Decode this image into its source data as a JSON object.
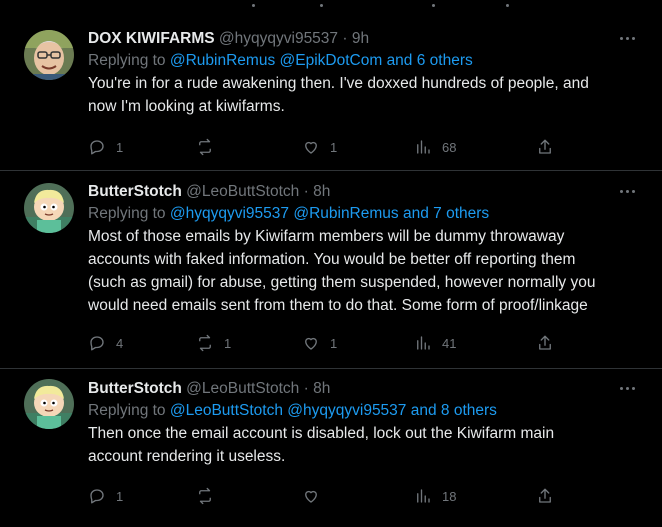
{
  "tweets": [
    {
      "name": "DOX KIWIFARMS",
      "handle": "@hyqyqyvi95537",
      "time": "9h",
      "replying_prefix": "Replying to",
      "replying_users": [
        "@RubinRemus",
        "@EpikDotCom"
      ],
      "replying_others": "and 6 others",
      "lines": [
        "You're in for a rude awakening then. I've doxxed hundreds of people, and",
        "now I'm looking at kiwifarms."
      ],
      "counts": {
        "replies": "1",
        "retweets": "",
        "likes": "1",
        "views": "68"
      },
      "avatar": "old-man-avatar"
    },
    {
      "name": "ButterStotch",
      "handle": "@LeoButtStotch",
      "time": "8h",
      "replying_prefix": "Replying to",
      "replying_users": [
        "@hyqyqyvi95537",
        "@RubinRemus"
      ],
      "replying_others": "and 7 others",
      "lines": [
        "Most of those emails by Kiwifarm members will be dummy throwaway",
        "accounts with faked information. You would be better off reporting them",
        "(such as gmail) for abuse, getting them suspended, however normally you",
        "would need emails sent from them to do that. Some form of proof/linkage"
      ],
      "counts": {
        "replies": "4",
        "retweets": "1",
        "likes": "1",
        "views": "41"
      },
      "avatar": "butters-avatar"
    },
    {
      "name": "ButterStotch",
      "handle": "@LeoButtStotch",
      "time": "8h",
      "replying_prefix": "Replying to",
      "replying_users": [
        "@LeoButtStotch",
        "@hyqyqyvi95537"
      ],
      "replying_others": "and 8 others",
      "lines": [
        "Then once the email account is disabled, lock out the Kiwifarm main",
        "account rendering it useless."
      ],
      "counts": {
        "replies": "1",
        "retweets": "",
        "likes": "",
        "views": "18"
      },
      "avatar": "butters-avatar"
    }
  ],
  "dot_separator": "·",
  "colors": {
    "background": "#000000",
    "text": "#e7e9ea",
    "muted": "#71767b",
    "link": "#1d9bf0",
    "divider": "#2f3336"
  }
}
